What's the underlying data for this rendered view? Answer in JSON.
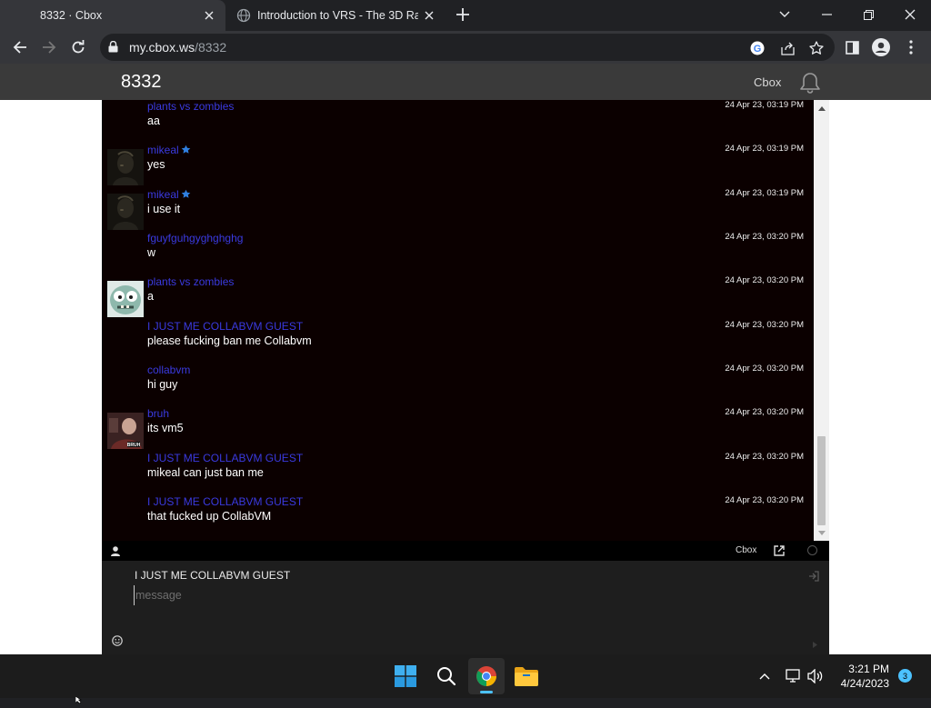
{
  "browser": {
    "tabs": [
      {
        "title": "8332 · Cbox",
        "active": true
      },
      {
        "title": "Introduction to VRS - The 3D Rac",
        "active": false
      }
    ],
    "url_host": "my.cbox.ws",
    "url_path": "/8332"
  },
  "site": {
    "title": "8332",
    "brand": "Cbox"
  },
  "chat": {
    "messages": [
      {
        "author": "plants vs zombies",
        "text": "aa",
        "time": "24 Apr 23, 03:19 PM",
        "avatar": "none",
        "starred": false
      },
      {
        "author": "mikeal",
        "text": "yes",
        "time": "24 Apr 23, 03:19 PM",
        "avatar": "dark-figure",
        "starred": true
      },
      {
        "author": "mikeal",
        "text": "i use it",
        "time": "24 Apr 23, 03:19 PM",
        "avatar": "dark-figure",
        "starred": true
      },
      {
        "author": "fguyfguhgyghghghg",
        "text": "w",
        "time": "24 Apr 23, 03:20 PM",
        "avatar": "none",
        "starred": false
      },
      {
        "author": "plants vs zombies",
        "text": "a",
        "time": "24 Apr 23, 03:20 PM",
        "avatar": "zombie",
        "starred": false
      },
      {
        "author": "I JUST ME COLLABVM GUEST",
        "text": "please fucking ban me Collabvm",
        "time": "24 Apr 23, 03:20 PM",
        "avatar": "none",
        "starred": false
      },
      {
        "author": "collabvm",
        "text": "hi guy",
        "time": "24 Apr 23, 03:20 PM",
        "avatar": "none",
        "starred": false
      },
      {
        "author": "bruh",
        "text": "its vm5",
        "time": "24 Apr 23, 03:20 PM",
        "avatar": "bruh-photo",
        "starred": false
      },
      {
        "author": "I JUST ME COLLABVM GUEST",
        "text": "mikeal can just ban me",
        "time": "24 Apr 23, 03:20 PM",
        "avatar": "none",
        "starred": false
      },
      {
        "author": "I JUST ME COLLABVM GUEST",
        "text": "that fucked up CollabVM",
        "time": "24 Apr 23, 03:20 PM",
        "avatar": "none",
        "starred": false
      }
    ],
    "bar_brand": "Cbox",
    "username": "I JUST ME COLLABVM GUEST",
    "message_placeholder": "message"
  },
  "taskbar": {
    "time": "3:21 PM",
    "date": "4/24/2023",
    "notification_count": "3"
  },
  "colors": {
    "chat_bg": "#0b0000",
    "author": "#3a3ae0",
    "header_bg": "#3a3a3a",
    "accent": "#4cc2ff"
  }
}
